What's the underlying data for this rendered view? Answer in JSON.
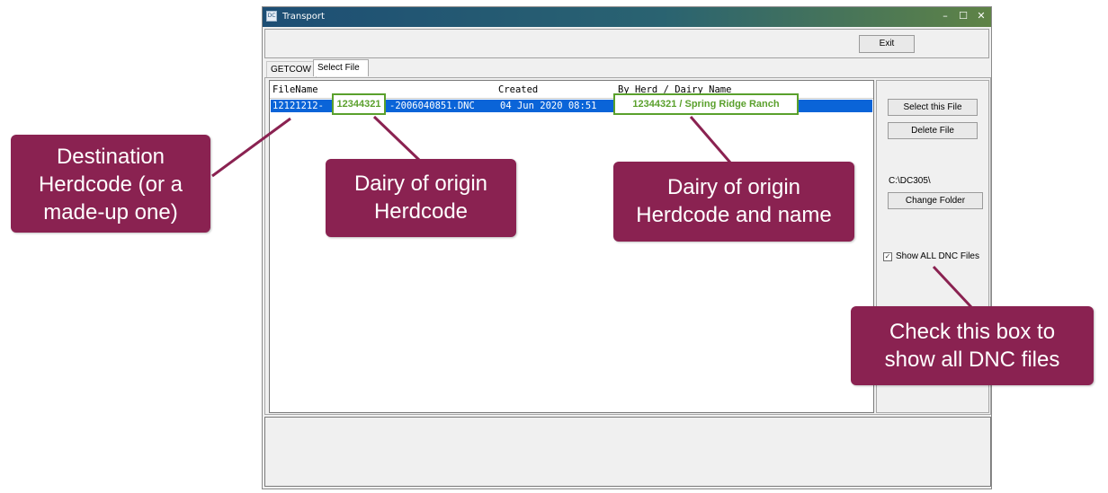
{
  "window": {
    "title": "Transport",
    "icon_text": "DC",
    "controls": {
      "minimize": "–",
      "maximize": "☐",
      "close": "✕"
    }
  },
  "toolbar": {
    "exit_label": "Exit"
  },
  "tabs": [
    {
      "label": "GETCOW",
      "active": false
    },
    {
      "label": "Select File",
      "active": true
    }
  ],
  "file_list": {
    "columns": [
      "FileName",
      "Created",
      "By Herd / Dairy Name"
    ],
    "rows": [
      {
        "filename": "12121212-12344321-2006040851.DNC",
        "created": "04 Jun 2020 08:51",
        "herd": "12344321 / Spring Ridge Ranch",
        "selected": true
      }
    ],
    "visible_prefix": "12121212-",
    "visible_suffix": "-2006040851.DNC",
    "visible_created": "04 Jun 2020 08:51",
    "selected_color": "#0a64d8"
  },
  "side_panel": {
    "select_label": "Select this File",
    "delete_label": "Delete File",
    "folder_path": "C:\\DC305\\",
    "change_folder_label": "Change Folder",
    "show_all_label": "Show ALL DNC Files",
    "show_all_checked": true
  },
  "callouts": {
    "destination": [
      "Destination",
      "Herdcode (or a",
      "made-up one)"
    ],
    "origin": [
      "Dairy of origin",
      "Herdcode"
    ],
    "origin_name": [
      "Dairy of origin",
      "Herdcode and name"
    ],
    "check_box": [
      "Check this box to",
      "show all DNC files"
    ],
    "highlight_herd": "12344321",
    "highlight_herd_name": "12344321 / Spring Ridge Ranch",
    "callout_color": "#8a2251",
    "highlight_color": "#5aa02c"
  }
}
